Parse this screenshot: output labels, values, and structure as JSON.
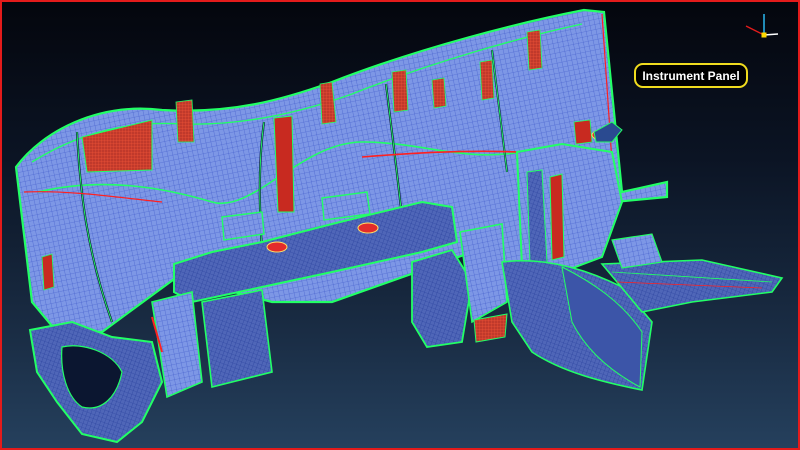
{
  "window": {
    "title_strip": "",
    "frame_color": "#e31b1b"
  },
  "viewport": {
    "background_top": "#04060d",
    "background_bottom": "#25405d",
    "mesh_fill": "#7d97e6",
    "mesh_line": "#3b56c8",
    "edge_color": "#22ff66",
    "feature_color": "#ff2020"
  },
  "annotation": {
    "label": "Instrument Panel",
    "border_color": "#f0dc1e"
  },
  "triad": {
    "icon": "axis-triad-icon",
    "x_color": "#e31b1b",
    "y_color": "#2cc4ff",
    "z_color": "#ffffff",
    "origin_color": "#ffd800"
  }
}
